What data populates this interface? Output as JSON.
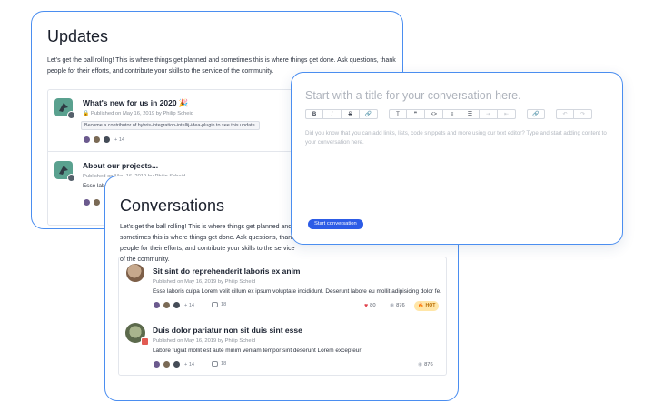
{
  "updates": {
    "title": "Updates",
    "intro": "Let's get the ball rolling! This is where things get planned and sometimes this is where things get done. Ask questions, thank people for their efforts, and contribute your skills to the service of the community.",
    "posts": [
      {
        "title": "What's new for us in 2020 🎉",
        "meta": "Published on May 16, 2019 by Philip Scheid",
        "notice": "Become a contributor of hybris-integration-intellij-idea-plugin to see this update.",
        "participants_more": "+ 14"
      },
      {
        "title": "About our projects...",
        "meta": "Published on May 16, 2019 by Philip Scheid",
        "excerpt": "Esse labo"
      }
    ]
  },
  "conversations": {
    "title": "Conversations",
    "intro": "Let's get the ball rolling! This is where things get planned and sometimes this is where things get done. Ask questions, thank people for their efforts, and contribute your skills to the service of the community.",
    "items": [
      {
        "title": "Sit sint do reprehenderit laboris ex anim",
        "meta": "Published on May 16, 2019 by Philip Scheid",
        "excerpt": "Esse laboris culpa Lorem velit cillum ex ipsum voluptate incididunt. Deserunt labore eu mollit adipisicing dolor fe...",
        "participants_more": "+ 14",
        "comments": "18",
        "likes": "80",
        "views": "876",
        "hot": "HOT"
      },
      {
        "title": "Duis dolor pariatur non sit duis sint esse",
        "meta": "Published on May 16, 2019 by Philip Scheid",
        "excerpt": "Labore fugiat mollit est aute minim veniam tempor sint deserunt Lorem excepteur",
        "participants_more": "+ 14",
        "comments": "18",
        "views": "876"
      }
    ]
  },
  "editor": {
    "title_placeholder": "Start with a title for your conversation here.",
    "body_placeholder": "Did you know that you can add links, lists, code snippets and more using our text editor? Type and start adding content to your conversation here.",
    "toolbar": {
      "bold": "B",
      "italic": "I",
      "strike": "S",
      "link": "🔗",
      "heading": "T",
      "quote": "❞",
      "code": "<>",
      "ordered_list": "≡",
      "bullet_list": "☰",
      "indent": "⇥",
      "outdent": "⇤",
      "attach": "🔗",
      "undo": "↶",
      "redo": "↷"
    },
    "start_button": "Start conversation"
  },
  "colors": {
    "accent_border": "#4b8ef0",
    "primary_button": "#2d5ce6",
    "like_heart": "#e0414b",
    "hot_badge_bg": "#ffe6a8"
  }
}
